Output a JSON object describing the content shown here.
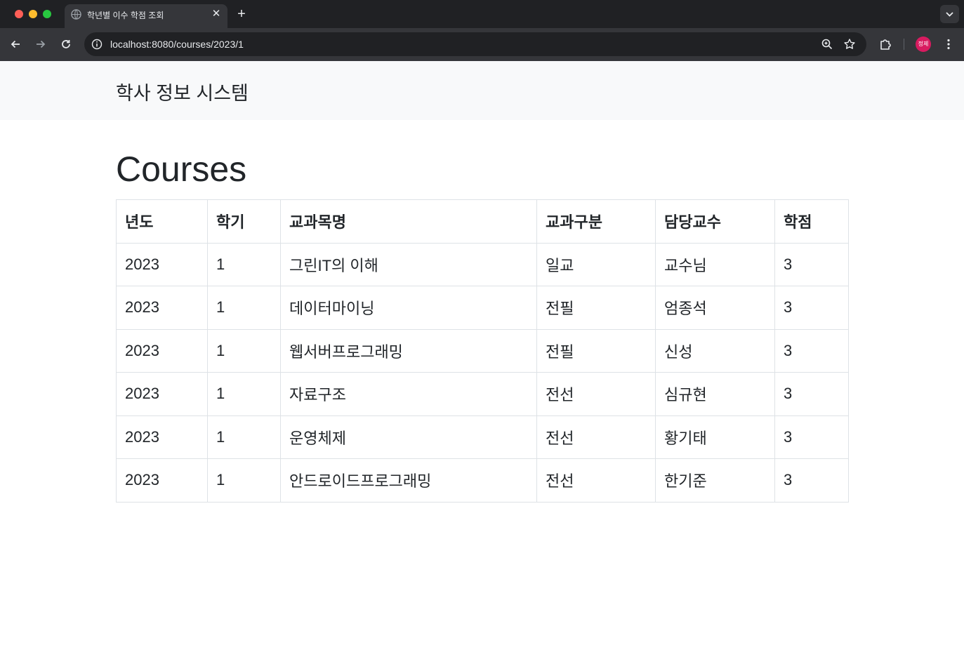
{
  "browser": {
    "tab_title": "학년별 이수 학점 조회",
    "url": "localhost:8080/courses/2023/1",
    "profile_initials": "정제"
  },
  "navbar": {
    "brand": "학사 정보 시스템"
  },
  "page": {
    "heading": "Courses"
  },
  "table": {
    "columns": [
      "년도",
      "학기",
      "교과목명",
      "교과구분",
      "담당교수",
      "학점"
    ],
    "rows": [
      [
        "2023",
        "1",
        "그린IT의 이해",
        "일교",
        "교수님",
        "3"
      ],
      [
        "2023",
        "1",
        "데이터마이닝",
        "전필",
        "엄종석",
        "3"
      ],
      [
        "2023",
        "1",
        "웹서버프로그래밍",
        "전필",
        "신성",
        "3"
      ],
      [
        "2023",
        "1",
        "자료구조",
        "전선",
        "심규현",
        "3"
      ],
      [
        "2023",
        "1",
        "운영체제",
        "전선",
        "황기태",
        "3"
      ],
      [
        "2023",
        "1",
        "안드로이드프로그래밍",
        "전선",
        "한기준",
        "3"
      ]
    ]
  },
  "colors": {
    "chrome_dark": "#202124",
    "chrome_toolbar": "#35363a",
    "navbar_bg": "#f8f9fa",
    "text": "#212529",
    "border": "#dee2e6",
    "avatar": "#d81b60"
  }
}
